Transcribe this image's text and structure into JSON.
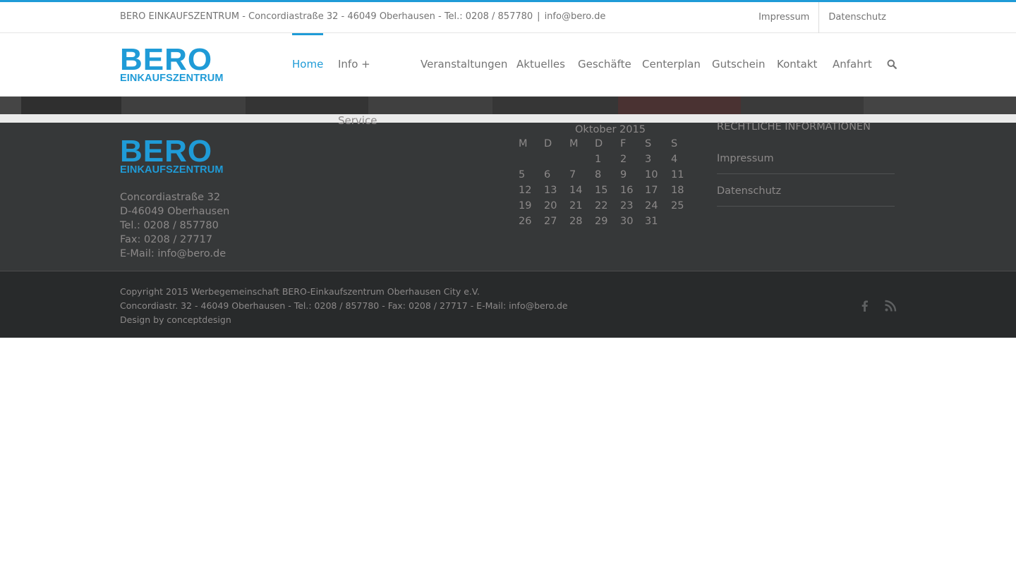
{
  "topbar": {
    "contact": "BERO EINKAUFSZENTRUM - Concordiastraße 32 - 46049 Oberhausen - Tel.: 0208 / 857780",
    "separator": "|",
    "email": "info@bero.de",
    "links": [
      "Impressum",
      "Datenschutz"
    ]
  },
  "logo": {
    "line1": "BERO",
    "line2": "EINKAUFSZENTRUM"
  },
  "nav": {
    "items": [
      "Home",
      "Info +",
      "Veranstaltungen",
      "Aktuelles",
      "Geschäfte",
      "Centerplan",
      "Gutschein",
      "Kontakt",
      "Anfahrt"
    ],
    "submenu": "Service",
    "search_icon": "search-icon"
  },
  "footer": {
    "address": [
      "Concordiastraße 32",
      "D-46049 Oberhausen",
      "Tel.: 0208 / 857780",
      "Fax: 0208 / 27717",
      "E-Mail: info@bero.de"
    ],
    "calendar": {
      "caption": "Oktober 2015",
      "weekdays": [
        "M",
        "D",
        "M",
        "D",
        "F",
        "S",
        "S"
      ],
      "weeks": [
        [
          "",
          "",
          "",
          "1",
          "2",
          "3",
          "4"
        ],
        [
          "5",
          "6",
          "7",
          "8",
          "9",
          "10",
          "11"
        ],
        [
          "12",
          "13",
          "14",
          "15",
          "16",
          "17",
          "18"
        ],
        [
          "19",
          "20",
          "21",
          "22",
          "23",
          "24",
          "25"
        ],
        [
          "26",
          "27",
          "28",
          "29",
          "30",
          "31",
          ""
        ]
      ]
    },
    "legal": {
      "heading": "RECHTLICHE INFORMATIONEN",
      "links": [
        "Impressum",
        "Datenschutz"
      ]
    }
  },
  "copyright": {
    "line1": "Copyright 2015 Werbegemeinschaft BERO-Einkaufszentrum Oberhausen City e.V.",
    "line2": "Concordiastr. 32 - 46049 Oberhausen - Tel.: 0208 / 857780 - Fax: 0208 / 27717 - E-Mail:  info@bero.de",
    "line3": "Design by conceptdesign",
    "social": [
      "facebook-icon",
      "rss-icon"
    ]
  },
  "colors": {
    "accent": "#1f9bd7",
    "footer_bg": "#363839",
    "copyright_bg": "#282a2b",
    "text_muted": "#8c8989"
  }
}
